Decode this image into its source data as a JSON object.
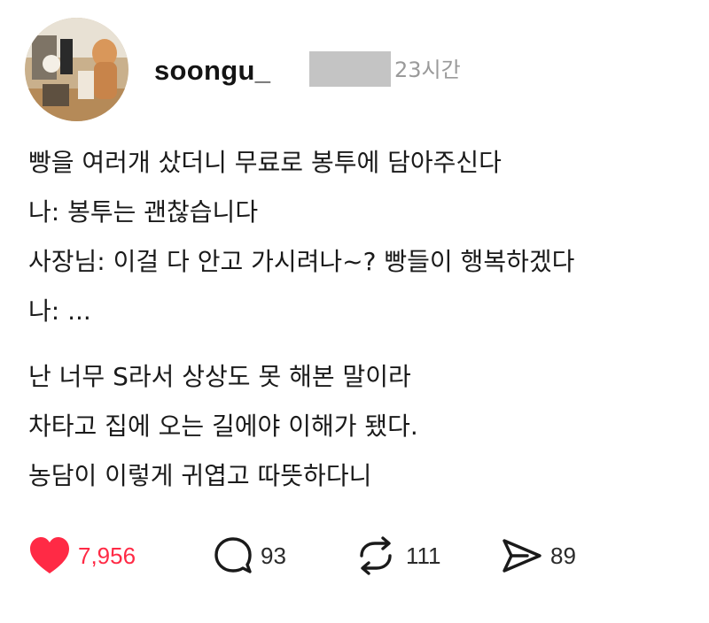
{
  "post": {
    "username": "soongu_",
    "timestamp": "23시간",
    "lines": [
      "빵을 여러개 샀더니 무료로 봉투에 담아주신다",
      "나: 봉투는 괜찮습니다",
      "사장님: 이걸 다 안고 가시려나~? 빵들이 행복하겠다",
      "나: ...",
      "난 너무 S라서 상상도 못 해본 말이라",
      "차타고 집에 오는 길에야 이해가 됐다.",
      "농담이 이렇게 귀엽고 따뜻하다니"
    ]
  },
  "actions": {
    "likes": "7,956",
    "comments": "93",
    "reposts": "111",
    "shares": "89"
  },
  "icons": {
    "like": "heart-icon",
    "comment": "comment-bubble-icon",
    "repost": "repost-arrows-icon",
    "share": "send-icon"
  },
  "colors": {
    "like_accent": "#ff2a45",
    "timestamp": "#9a9a9a",
    "redaction": "#c4c4c4"
  }
}
